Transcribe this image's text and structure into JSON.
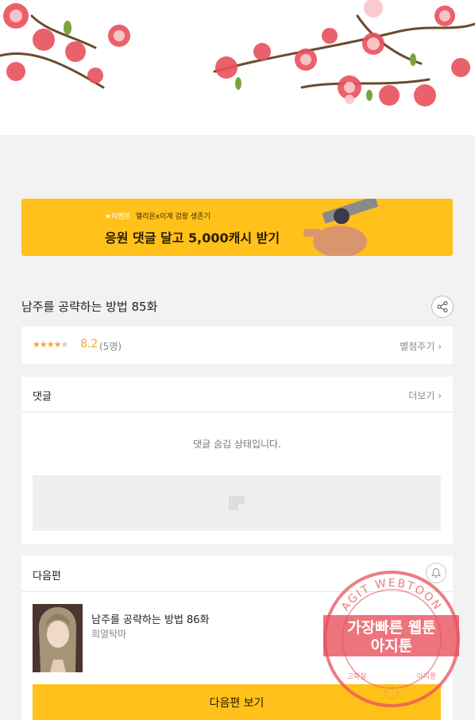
{
  "banner": {
    "event_tag": "★이벤트",
    "subtitle": "엘리온x이계 검왕 생존기",
    "headline": "응원 댓글 달고 5,000캐시 받기"
  },
  "episode": {
    "title": "남주를 공략하는 방법 85화"
  },
  "rating": {
    "stars_filled": 4,
    "stars_total": 5,
    "score": "8.2",
    "count": "(5명)",
    "rate_label": "별점주기 ›"
  },
  "comments": {
    "label": "댓글",
    "more_label": "더보기 ›",
    "hidden_message": "댓글 숨김 상태입니다."
  },
  "next": {
    "label": "다음편",
    "episode_title": "남주를 공략하는 방법 86화",
    "author": "희열탁마",
    "button_label": "다음편 보기"
  },
  "watermark": {
    "ring_text": "AGIT WEBTOON",
    "line1": "가장빠른 웹툰",
    "line2": "아지툰",
    "bottom_left": "고화질",
    "bottom_right": "아지툰"
  },
  "colors": {
    "accent": "#ffc11a",
    "star": "#f5a623",
    "watermark": "#e8505b"
  },
  "icons": {
    "share": "share-icon",
    "bell": "bell-icon",
    "image_placeholder": "image-placeholder-icon"
  }
}
